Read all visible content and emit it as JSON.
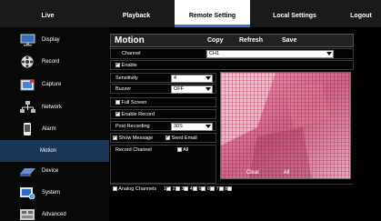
{
  "nav": {
    "tabs": [
      "Live",
      "Playback",
      "Remote Setting",
      "Local Settings",
      "Logout"
    ],
    "active": "Remote Setting"
  },
  "sidebar": {
    "items": [
      {
        "label": "Display",
        "icon": "monitor-icon"
      },
      {
        "label": "Record",
        "icon": "film-reel-icon"
      },
      {
        "label": "Capture",
        "icon": "capture-icon"
      },
      {
        "label": "Network",
        "icon": "network-icon"
      },
      {
        "label": "Alarm",
        "icon": "alarm-phone-icon"
      },
      {
        "label": "Motion",
        "icon": ""
      },
      {
        "label": "Device",
        "icon": "hard-disk-icon"
      },
      {
        "label": "System",
        "icon": "system-settings-icon"
      },
      {
        "label": "Advanced",
        "icon": "advanced-board-icon"
      }
    ],
    "selected": "Motion"
  },
  "panel": {
    "title": "Motion",
    "copy_label": "Copy",
    "refresh_label": "Refresh",
    "save_label": "Save",
    "channel_label": "Channel",
    "channel_value": "CH1",
    "enable_label": "Enable",
    "sensitivity_label": "Sensitivity",
    "sensitivity_value": "4",
    "buzzer_label": "Buzzer",
    "buzzer_value": "OFF",
    "fullscreen_label": "Full Screen",
    "enable_record_label": "Enable Record",
    "post_recording_label": "Post Recording",
    "post_recording_value": "30S",
    "show_message_label": "Show Message",
    "send_email_label": "Send Email",
    "record_channel_label": "Record Channel",
    "all_label": "All",
    "clear_label": "Clear",
    "all_button_label": "All",
    "analog_label": "Analog Channels",
    "channels": [
      "1",
      "2",
      "3",
      "4",
      "5",
      "6",
      "7",
      "8"
    ]
  },
  "colors": {
    "accent": "#3a78c8",
    "selected_side": "#1c3658",
    "grid": "#b8003a"
  }
}
